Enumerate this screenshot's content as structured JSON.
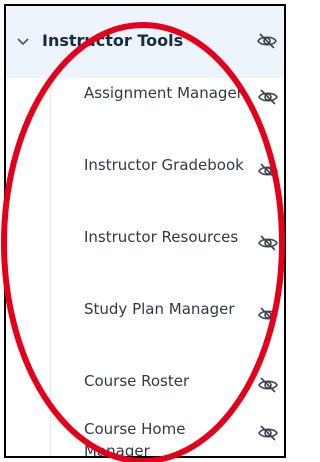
{
  "section": {
    "title": "Instructor Tools",
    "icons": {
      "chevron": "chevron-down-icon",
      "visibility": "eye-off-icon"
    }
  },
  "items": [
    {
      "label": "Assignment Manager"
    },
    {
      "label": "Instructor Gradebook"
    },
    {
      "label": "Instructor Resources"
    },
    {
      "label": "Study Plan Manager"
    },
    {
      "label": "Course Roster"
    },
    {
      "label": "Course Home Manager"
    }
  ],
  "colors": {
    "header_bg": "#edf4fb",
    "text": "#2f3a45",
    "icon": "#3a4550",
    "annotation": "#e4001b"
  }
}
